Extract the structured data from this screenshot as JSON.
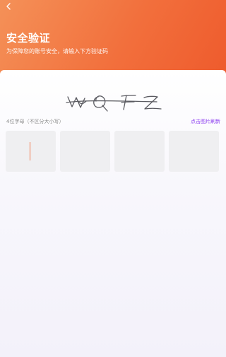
{
  "header": {
    "title": "安全验证",
    "subtitle": "为保障您的账号安全，请输入下方验证码"
  },
  "captcha": {
    "hint": "4位字母（不区分大小写）",
    "refresh_label": "点击图片刷新"
  },
  "code_inputs": [
    {
      "value": ""
    },
    {
      "value": ""
    },
    {
      "value": ""
    },
    {
      "value": ""
    }
  ],
  "colors": {
    "header_start": "#f49158",
    "header_end": "#ee5a2c",
    "refresh_link": "#8b3cf0",
    "caret": "#f2774b"
  }
}
